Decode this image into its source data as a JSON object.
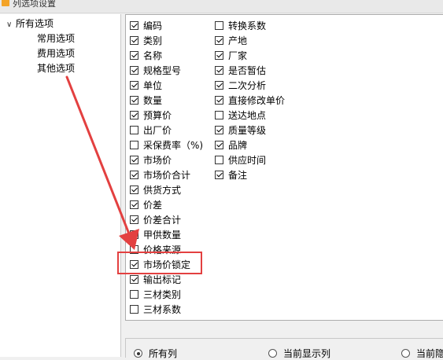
{
  "window": {
    "title": "列选项设置"
  },
  "tree": {
    "root": "所有选项",
    "children": [
      "常用选项",
      "费用选项",
      "其他选项"
    ]
  },
  "options": {
    "column1": [
      {
        "label": "编码",
        "checked": true
      },
      {
        "label": "类别",
        "checked": true
      },
      {
        "label": "名称",
        "checked": true
      },
      {
        "label": "规格型号",
        "checked": true
      },
      {
        "label": "单位",
        "checked": true
      },
      {
        "label": "数量",
        "checked": true
      },
      {
        "label": "预算价",
        "checked": true
      },
      {
        "label": "出厂价",
        "checked": false
      },
      {
        "label": "采保费率（%)",
        "checked": false
      },
      {
        "label": "市场价",
        "checked": true
      },
      {
        "label": "市场价合计",
        "checked": true
      },
      {
        "label": "供货方式",
        "checked": true
      },
      {
        "label": "价差",
        "checked": true
      },
      {
        "label": "价差合计",
        "checked": true
      },
      {
        "label": "甲供数量",
        "checked": false
      },
      {
        "label": "价格来源",
        "checked": false
      },
      {
        "label": "市场价锁定",
        "checked": true
      },
      {
        "label": "输出标记",
        "checked": true
      },
      {
        "label": "三材类别",
        "checked": false
      },
      {
        "label": "三材系数",
        "checked": false
      }
    ],
    "column2": [
      {
        "label": "转换系数",
        "checked": false
      },
      {
        "label": "产地",
        "checked": true
      },
      {
        "label": "厂家",
        "checked": true
      },
      {
        "label": "是否暂估",
        "checked": true
      },
      {
        "label": "二次分析",
        "checked": true
      },
      {
        "label": "直接修改单价",
        "checked": true
      },
      {
        "label": "送达地点",
        "checked": false
      },
      {
        "label": "质量等级",
        "checked": true
      },
      {
        "label": "品牌",
        "checked": true
      },
      {
        "label": "供应时间",
        "checked": false
      },
      {
        "label": "备注",
        "checked": true
      }
    ]
  },
  "scope": {
    "options": [
      "所有列",
      "当前显示列",
      "当前隐"
    ],
    "selected": 0
  },
  "colors": {
    "annotation": "#e34040"
  }
}
